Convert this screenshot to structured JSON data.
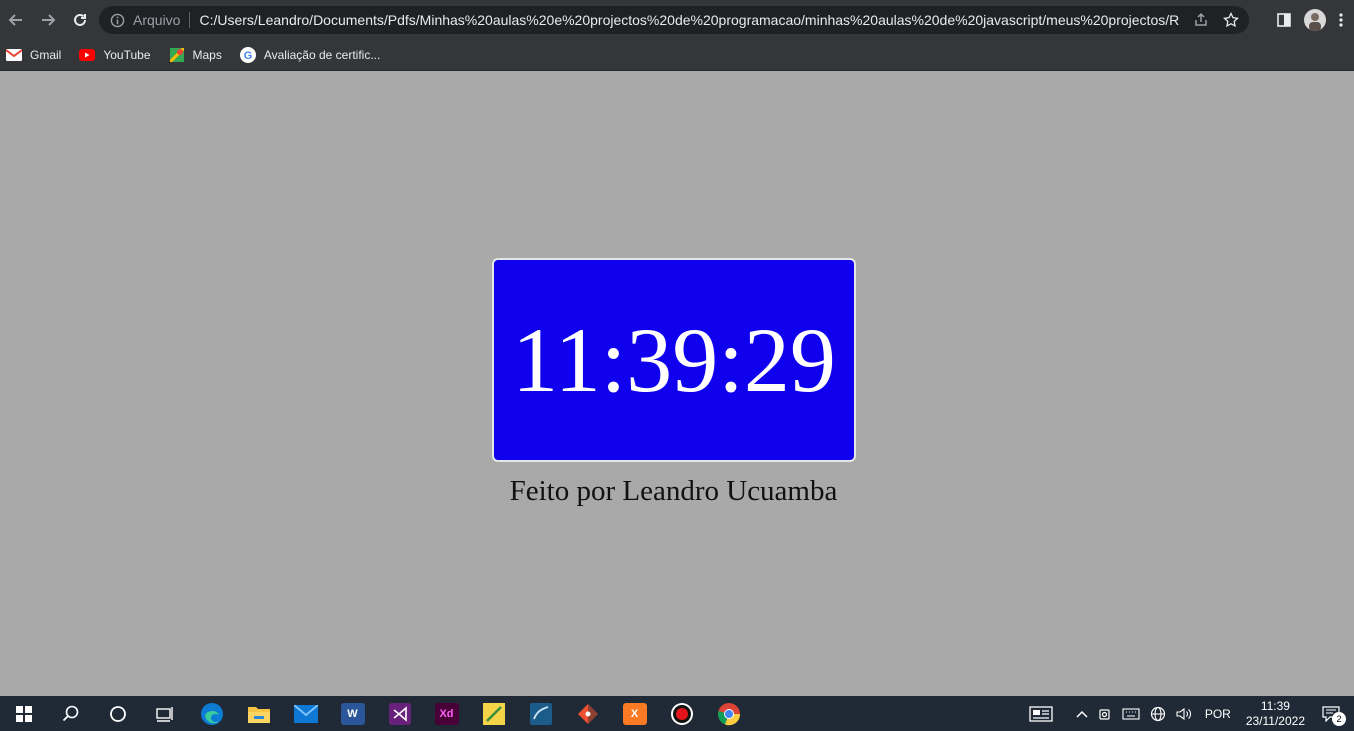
{
  "browser": {
    "scheme_label": "Arquivo",
    "url": "C:/Users/Leandro/Documents/Pdfs/Minhas%20aulas%20e%20projectos%20de%20programacao/minhas%20aulas%20de%20javascript/meus%20projectos/Re..."
  },
  "bookmarks": [
    {
      "label": "Gmail",
      "icon": "gmail-icon"
    },
    {
      "label": "YouTube",
      "icon": "youtube-icon"
    },
    {
      "label": "Maps",
      "icon": "maps-icon"
    },
    {
      "label": "Avaliação de certific...",
      "icon": "google-icon"
    }
  ],
  "page": {
    "clock_time": "11:39:29",
    "credit": "Feito por Leandro Ucuamba",
    "background_color": "#a9a9a9",
    "clock_background_color": "#0f00ee"
  },
  "taskbar": {
    "apps": [
      "edge",
      "file-explorer",
      "mail",
      "word",
      "visual-studio",
      "adobe-xd",
      "sticky-app",
      "mysql-workbench",
      "git",
      "xampp",
      "recorder",
      "chrome"
    ],
    "language": "POR",
    "time": "11:39",
    "date": "23/11/2022",
    "notification_count": "2"
  }
}
